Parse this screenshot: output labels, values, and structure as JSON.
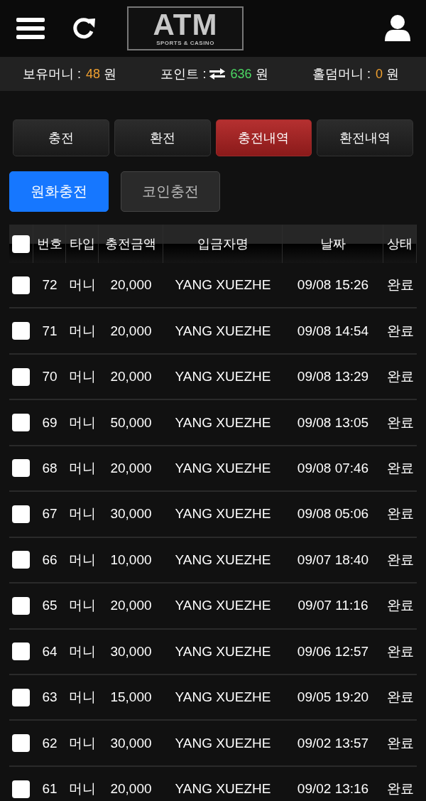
{
  "header": {
    "logo_title": "ATM",
    "logo_subtitle": "SPORTS & CASINO"
  },
  "balances": [
    {
      "label": "보유머니 :",
      "value": "48",
      "unit": "원",
      "color": "#f0a030",
      "kind": "plain"
    },
    {
      "label": "포인트 :",
      "value": "636",
      "unit": "원",
      "color": "#4cd964",
      "kind": "exchange"
    },
    {
      "label": "홀덤머니 :",
      "value": "0",
      "unit": "원",
      "color": "#f0a030",
      "kind": "plain"
    }
  ],
  "tabs": [
    {
      "label": "충전",
      "selected": false
    },
    {
      "label": "환전",
      "selected": false
    },
    {
      "label": "충전내역",
      "selected": true
    },
    {
      "label": "환전내역",
      "selected": false
    }
  ],
  "subtabs": [
    {
      "label": "원화충전",
      "selected": true
    },
    {
      "label": "코인충전",
      "selected": false
    }
  ],
  "table": {
    "select_all_checked": false,
    "columns": [
      "번호",
      "타입",
      "충전금액",
      "입금자명",
      "날짜",
      "상태"
    ],
    "rows": [
      {
        "checked": false,
        "cells": [
          "72",
          "머니",
          "20,000",
          "YANG XUEZHE",
          "09/08 15:26",
          "완료"
        ]
      },
      {
        "checked": false,
        "cells": [
          "71",
          "머니",
          "20,000",
          "YANG XUEZHE",
          "09/08 14:54",
          "완료"
        ]
      },
      {
        "checked": false,
        "cells": [
          "70",
          "머니",
          "20,000",
          "YANG XUEZHE",
          "09/08 13:29",
          "완료"
        ]
      },
      {
        "checked": false,
        "cells": [
          "69",
          "머니",
          "50,000",
          "YANG XUEZHE",
          "09/08 13:05",
          "완료"
        ]
      },
      {
        "checked": false,
        "cells": [
          "68",
          "머니",
          "20,000",
          "YANG XUEZHE",
          "09/08 07:46",
          "완료"
        ]
      },
      {
        "checked": false,
        "cells": [
          "67",
          "머니",
          "30,000",
          "YANG XUEZHE",
          "09/08 05:06",
          "완료"
        ]
      },
      {
        "checked": false,
        "cells": [
          "66",
          "머니",
          "10,000",
          "YANG XUEZHE",
          "09/07 18:40",
          "완료"
        ]
      },
      {
        "checked": false,
        "cells": [
          "65",
          "머니",
          "20,000",
          "YANG XUEZHE",
          "09/07 11:16",
          "완료"
        ]
      },
      {
        "checked": false,
        "cells": [
          "64",
          "머니",
          "30,000",
          "YANG XUEZHE",
          "09/06 12:57",
          "완료"
        ]
      },
      {
        "checked": false,
        "cells": [
          "63",
          "머니",
          "15,000",
          "YANG XUEZHE",
          "09/05 19:20",
          "완료"
        ]
      },
      {
        "checked": false,
        "cells": [
          "62",
          "머니",
          "30,000",
          "YANG XUEZHE",
          "09/02 13:57",
          "완료"
        ]
      },
      {
        "checked": false,
        "cells": [
          "61",
          "머니",
          "20,000",
          "YANG XUEZHE",
          "09/02 13:16",
          "완료"
        ]
      }
    ]
  }
}
